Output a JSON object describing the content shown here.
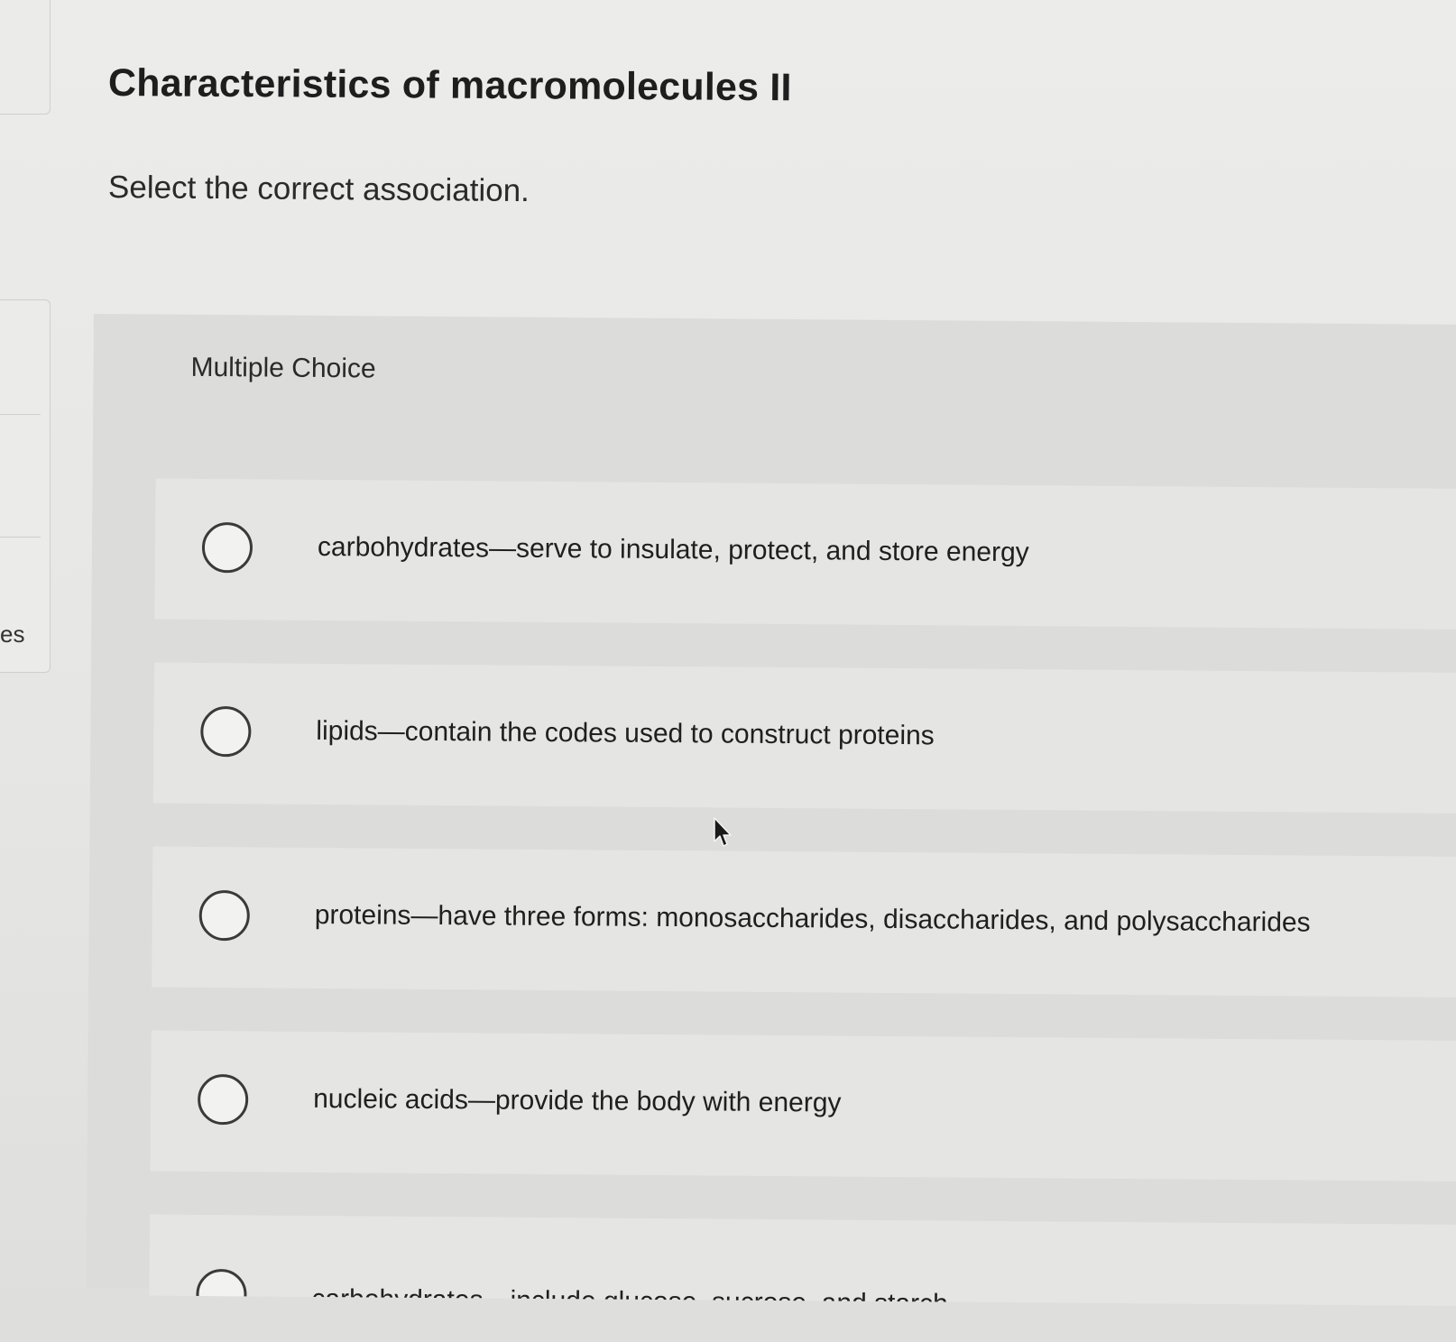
{
  "sidebar": {
    "partial_label": "es"
  },
  "page": {
    "title": "Characteristics of macromolecules II",
    "instruction": "Select the correct association."
  },
  "question": {
    "type_label": "Multiple Choice",
    "options": [
      {
        "label": "carbohydrates—serve to insulate, protect, and store energy",
        "selected": false
      },
      {
        "label": "lipids—contain the codes used to construct proteins",
        "selected": false
      },
      {
        "label": "proteins—have three forms: monosaccharides, disaccharides, and polysaccharides",
        "selected": false
      },
      {
        "label": "nucleic acids—provide the body with energy",
        "selected": false
      },
      {
        "label": "carbohydrates—include glucose, sucrose, and starch",
        "selected": false
      }
    ]
  },
  "icons": {
    "radio": "radio-unchecked-icon",
    "cursor": "mouse-pointer-icon"
  },
  "colors": {
    "background": "#e4e4e2",
    "panel": "#dcdcda",
    "option_row": "#e5e5e3",
    "text": "#1f1f1f"
  }
}
